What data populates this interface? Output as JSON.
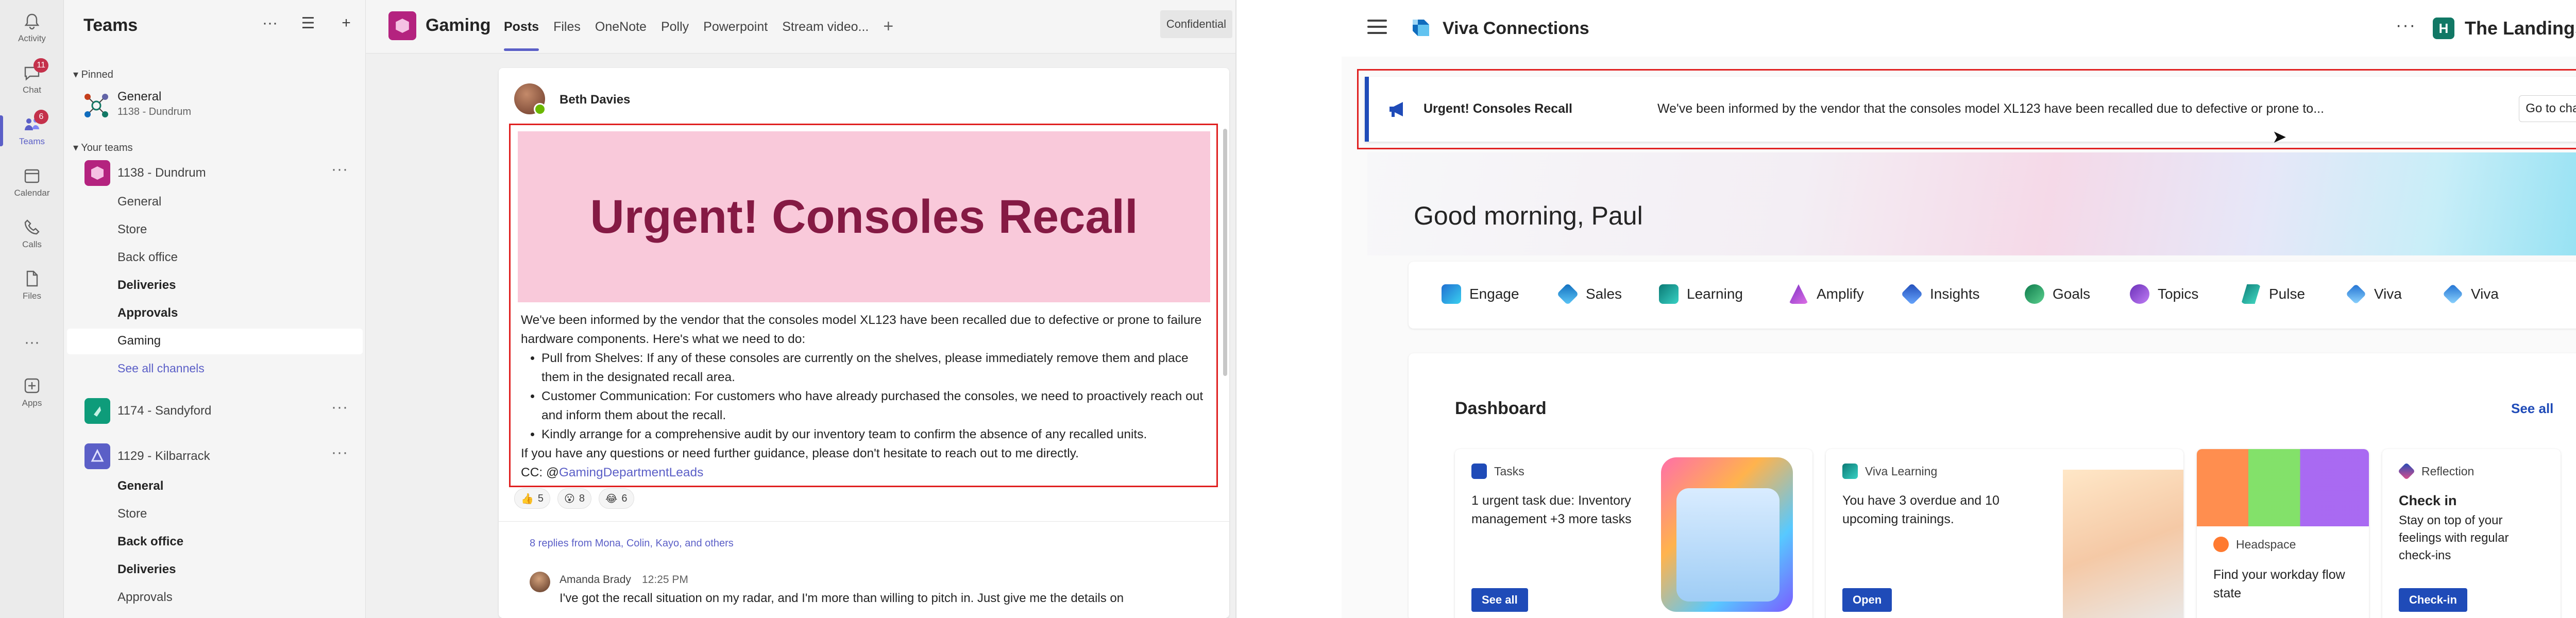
{
  "teams": {
    "rail": [
      {
        "label": "Activity",
        "icon": "bell-icon"
      },
      {
        "label": "Chat",
        "icon": "chat-icon",
        "badge": "11"
      },
      {
        "label": "Teams",
        "icon": "teams-icon",
        "badge": "6",
        "active": true
      },
      {
        "label": "Calendar",
        "icon": "calendar-icon"
      },
      {
        "label": "Calls",
        "icon": "phone-icon"
      },
      {
        "label": "Files",
        "icon": "file-icon"
      },
      {
        "label": "···",
        "icon": "more-icon"
      },
      {
        "label": "Apps",
        "icon": "apps-icon"
      }
    ],
    "list": {
      "title": "Teams",
      "pinned_label": "Pinned",
      "pinned": {
        "name": "General",
        "sub": "1138 - Dundrum"
      },
      "your_teams_label": "Your teams",
      "team1": {
        "name": "1138 - Dundrum",
        "channels": [
          "General",
          "Store",
          "Back office",
          "Deliveries",
          "Approvals",
          "Gaming",
          "See all channels"
        ]
      },
      "team2": {
        "name": "1174 - Sandyford"
      },
      "team3": {
        "name": "1129 - Kilbarrack",
        "channels": [
          "General",
          "Store",
          "Back office",
          "Deliveries",
          "Approvals"
        ]
      }
    },
    "channel": {
      "title": "Gaming",
      "tabs": [
        "Posts",
        "Files",
        "OneNote",
        "Polly",
        "Powerpoint",
        "Stream video..."
      ],
      "add_tab": "+",
      "confidential": "Confidential",
      "post": {
        "author": "Beth Davies",
        "banner": "Urgent! Consoles Recall",
        "intro": "We've been informed by the vendor that the consoles model XL123 have been recalled due to defective or prone to failure hardware components. Here's what we need to do:",
        "bullets": [
          "Pull from Shelves: If any of these consoles are currently on the shelves, please immediately remove them and place them in the designated recall area.",
          "Customer Communication: For customers who have already purchased the consoles, we need to proactively reach out and inform them about the recall.",
          "Kindly arrange for a comprehensive audit by our inventory team to confirm the absence of any recalled units."
        ],
        "closing": "If you have any questions or need further guidance, please don't hesitate to reach out to me directly.",
        "cc_prefix": "CC: @",
        "cc_mention": "GamingDepartmentLeads",
        "reactions": [
          {
            "emoji": "👍",
            "count": "5"
          },
          {
            "emoji": "😮",
            "count": "8"
          },
          {
            "emoji": "😂",
            "count": "6"
          }
        ],
        "replies_summary": "8 replies from Mona, Colin, Kayo, and others",
        "reply": {
          "name": "Amanda Brady",
          "time": "12:25 PM",
          "text": "I've got the recall situation on my radar, and I'm more than willing to pitch in. Just give me the details on"
        }
      }
    }
  },
  "viva": {
    "title": "Viva Connections",
    "more": "···",
    "site_initial": "H",
    "site": "The Landings",
    "chevron": ">",
    "alert": {
      "title": "Urgent! Consoles Recall",
      "text": "We've been informed by the vendor that the consoles model XL123 have been recalled due to defective or prone to...",
      "button": "Go to channel"
    },
    "greeting": "Good morning, Paul",
    "apps": [
      "Engage",
      "Sales",
      "Learning",
      "Amplify",
      "Insights",
      "Goals",
      "Topics",
      "Pulse",
      "Viva",
      "Viva"
    ],
    "apps_next": ">",
    "dashboard": {
      "title": "Dashboard",
      "see_all": "See all",
      "cards": [
        {
          "app": "Tasks",
          "body": "1 urgent task due: Inventory management +3 more tasks",
          "button": "See all"
        },
        {
          "app": "Viva Learning",
          "body": "You have 3 overdue and 10 upcoming trainings.",
          "button": "Open"
        },
        {
          "app": "Headspace",
          "body": "Find your workday flow state"
        },
        {
          "app": "Reflection",
          "title": "Check in",
          "body": "Stay on top of your feelings with regular check-ins",
          "button": "Check-in"
        }
      ]
    },
    "colors": {
      "accent": "#1f4bb8",
      "alert_border": "#e02020",
      "teams_purple": "#5b5fc7",
      "banner_bg": "#f9c9da",
      "banner_text": "#851a44"
    }
  }
}
